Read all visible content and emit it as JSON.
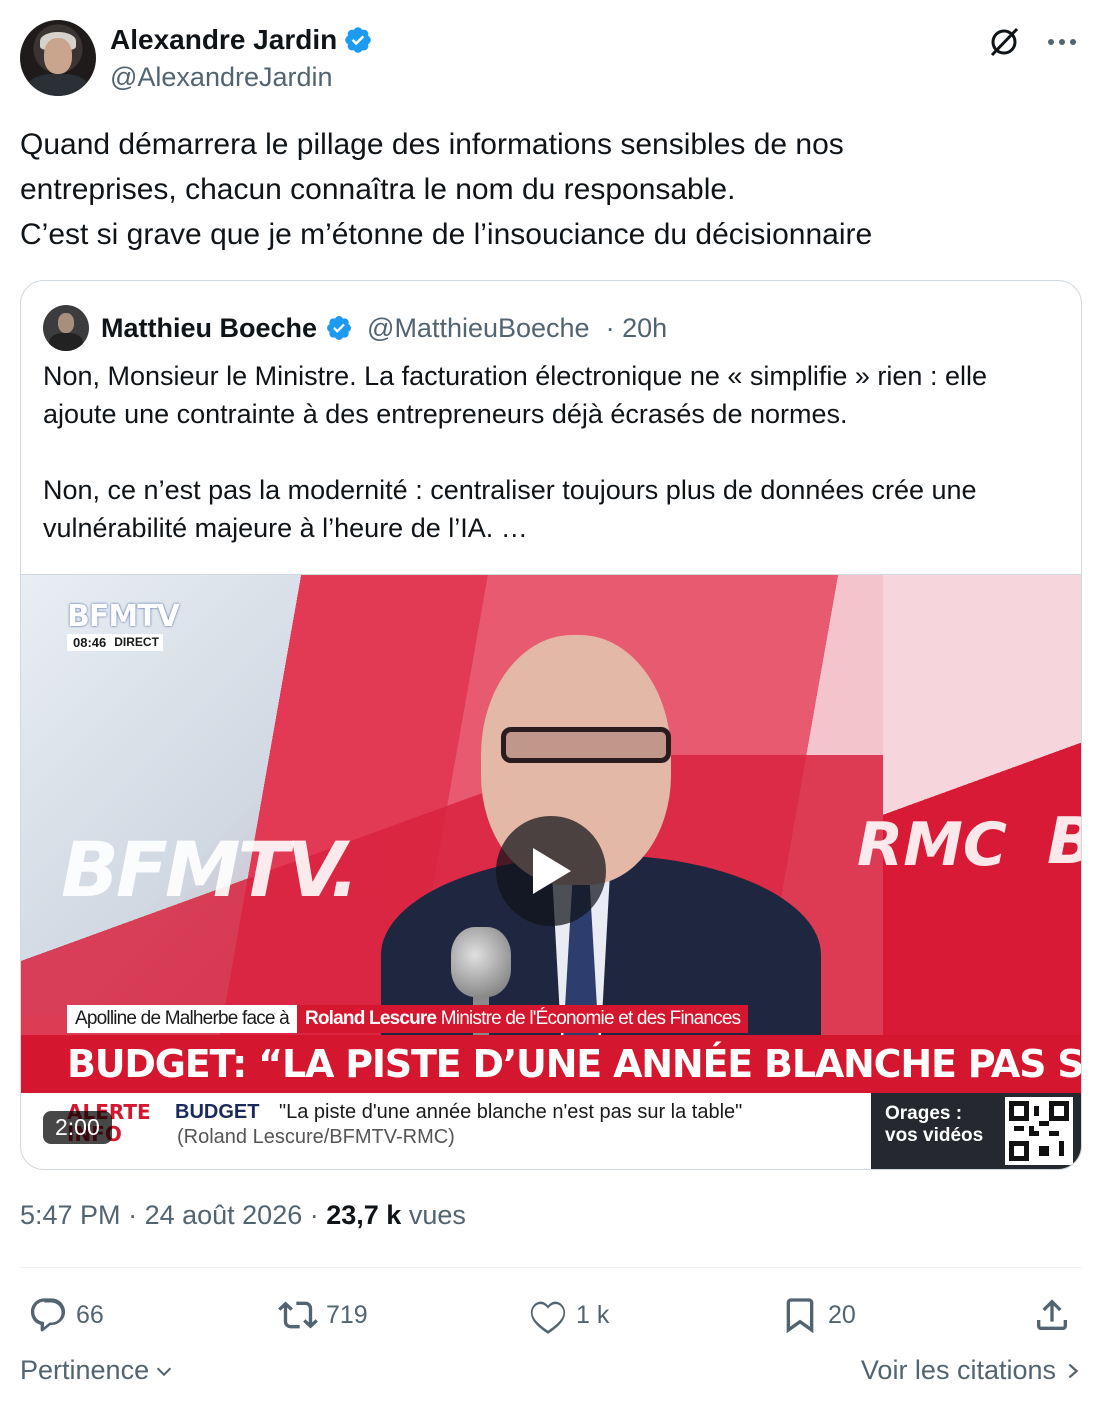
{
  "author": {
    "display_name": "Alexandre Jardin",
    "handle": "@AlexandreJardin",
    "verified": true
  },
  "icons": {
    "grok": "grok-icon",
    "more": "more-icon",
    "verified": "verified-badge-icon"
  },
  "tweet": {
    "lines": [
      "Quand démarrera le pillage des informations sensibles de nos",
      "entreprises, chacun connaîtra le nom du responsable.",
      "C’est si grave que je m’étonne de l’insouciance du décisionnaire"
    ]
  },
  "quote": {
    "display_name": "Matthieu Boeche",
    "handle": "@MatthieuBoeche",
    "time": "· 20h",
    "paragraph1_line1": "Non, Monsieur le Ministre. La facturation électronique ne « simplifie » rien : elle",
    "paragraph1_line2": "ajoute une contrainte à des entrepreneurs déjà écrasés de normes.",
    "paragraph2_line1": "Non, ce n’est pas la modernité : centraliser toujours plus de données crée une",
    "paragraph2_line2": "vulnérabilité majeure à l’heure de l’IA. …",
    "video": {
      "channel_logo": "BFMTV",
      "logo_time": "08:46",
      "logo_live": "DIRECT",
      "watermark_left": "BFMTV.",
      "watermark_right": "RMC",
      "watermark_edge": "B",
      "lower_third_host": "Apolline de Malherbe face à",
      "lower_third_guest": "Roland Lescure",
      "lower_third_role": "Ministre de l'Économie et des Finances",
      "headline": "BUDGET: “LA PISTE D’UNE ANNÉE BLANCHE PAS SUR LA TABLE”",
      "ticker_alert_1": "ALERTE",
      "ticker_alert_2": "INFO",
      "ticker_label": "BUDGET",
      "ticker_quote": "\"La piste d'une année blanche n'est pas sur la table\"",
      "ticker_source": "(Roland Lescure/BFMTV-RMC)",
      "promo_line1": "Orages :",
      "promo_line2": "vos vidéos",
      "duration": "2:00"
    }
  },
  "meta": {
    "time": "5:47 PM",
    "date": "24 août 2026",
    "views_count": "23,7 k",
    "views_label": "vues"
  },
  "actions": {
    "replies": "66",
    "reposts": "719",
    "likes": "1 k",
    "bookmarks": "20"
  },
  "footer": {
    "sort_label": "Pertinence",
    "quotes_label": "Voir les citations"
  },
  "colors": {
    "text_primary": "#0f1419",
    "text_secondary": "#536471",
    "verified_blue": "#1d9bf0",
    "border": "#cfd9de",
    "bfm_red": "#d4162e"
  }
}
